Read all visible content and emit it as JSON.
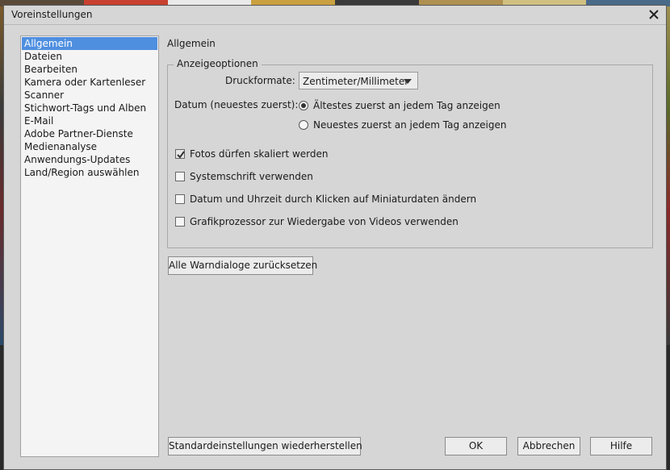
{
  "window": {
    "title": "Voreinstellungen"
  },
  "sidebar": {
    "items": [
      {
        "label": "Allgemein",
        "selected": true
      },
      {
        "label": "Dateien"
      },
      {
        "label": "Bearbeiten"
      },
      {
        "label": "Kamera oder Kartenleser"
      },
      {
        "label": "Scanner"
      },
      {
        "label": "Stichwort-Tags und Alben"
      },
      {
        "label": "E-Mail"
      },
      {
        "label": "Adobe Partner-Dienste"
      },
      {
        "label": "Medienanalyse"
      },
      {
        "label": "Anwendungs-Updates"
      },
      {
        "label": "Land/Region auswählen"
      }
    ]
  },
  "main": {
    "section_title": "Allgemein",
    "group": {
      "legend": "Anzeigeoptionen",
      "print_format_label": "Druckformate:",
      "print_format_value": "Zentimeter/Millimeter",
      "date_label": "Datum (neuestes zuerst):",
      "date_options": [
        {
          "label": "Ältestes zuerst an jedem Tag anzeigen",
          "selected": true
        },
        {
          "label": "Neuestes zuerst an jedem Tag anzeigen",
          "selected": false
        }
      ],
      "checkboxes": [
        {
          "label": "Fotos dürfen skaliert werden",
          "checked": true
        },
        {
          "label": "Systemschrift verwenden",
          "checked": false
        },
        {
          "label": "Datum und Uhrzeit durch Klicken auf Miniaturdaten ändern",
          "checked": false
        },
        {
          "label": "Grafikprozessor zur Wiedergabe von Videos verwenden",
          "checked": false
        }
      ]
    },
    "reset_warnings_button": "Alle Warndialoge zurücksetzen"
  },
  "footer": {
    "restore_defaults_button": "Standardeinstellungen wiederherstellen",
    "ok_button": "OK",
    "cancel_button": "Abbrechen",
    "help_button": "Hilfe"
  },
  "colors": {
    "dialog_bg": "#d6d6d6",
    "selection": "#4f8fe0",
    "list_bg": "#f4f4f4"
  }
}
